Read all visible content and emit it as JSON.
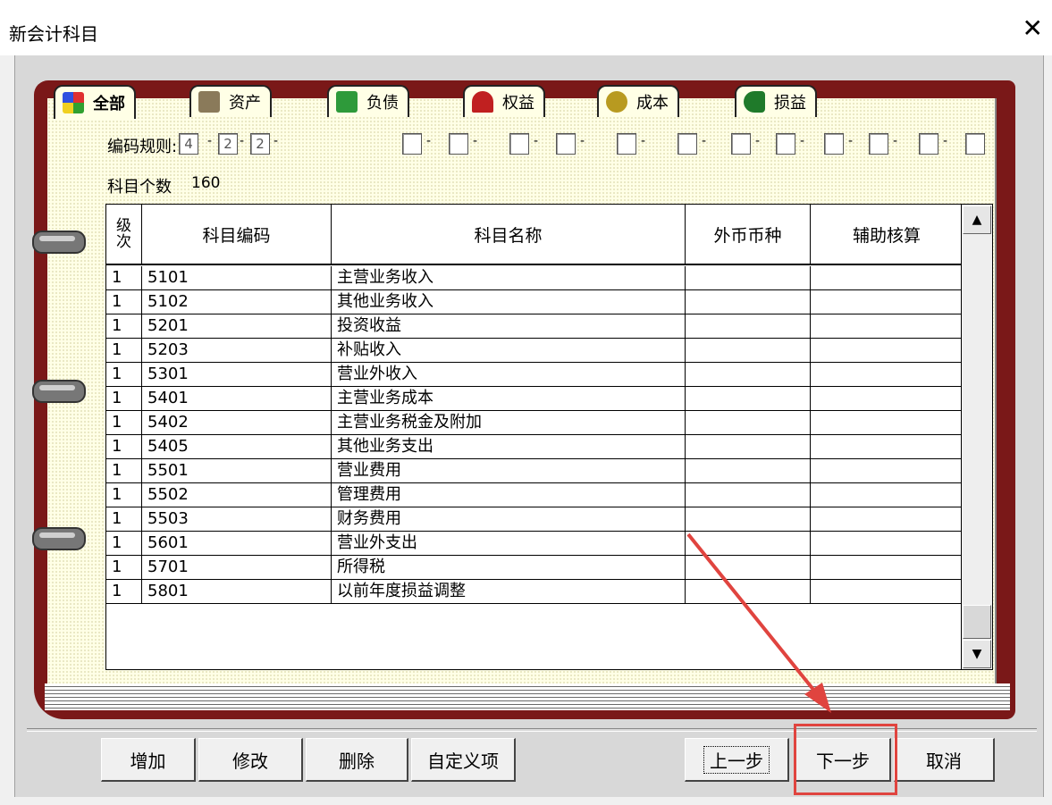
{
  "window": {
    "title": "新会计科目",
    "close": "✕"
  },
  "tabs": [
    {
      "label": "全部",
      "icon": "all-icon",
      "active": true
    },
    {
      "label": "资产",
      "icon": "asset-icon"
    },
    {
      "label": "负债",
      "icon": "liability-icon"
    },
    {
      "label": "权益",
      "icon": "equity-icon"
    },
    {
      "label": "成本",
      "icon": "cost-icon"
    },
    {
      "label": "损益",
      "icon": "profit-loss-icon"
    }
  ],
  "coding_rule": {
    "label": "编码规则:",
    "values": [
      "4",
      "2",
      "2"
    ]
  },
  "account_count": {
    "label": "科目个数",
    "value": "160"
  },
  "table": {
    "headers": [
      "级次",
      "科目编码",
      "科目名称",
      "外币币种",
      "辅助核算"
    ],
    "rows": [
      {
        "level": "1",
        "code": "5101",
        "name": "主营业务收入"
      },
      {
        "level": "1",
        "code": "5102",
        "name": "其他业务收入"
      },
      {
        "level": "1",
        "code": "5201",
        "name": "投资收益"
      },
      {
        "level": "1",
        "code": "5203",
        "name": "补贴收入"
      },
      {
        "level": "1",
        "code": "5301",
        "name": "营业外收入"
      },
      {
        "level": "1",
        "code": "5401",
        "name": "主营业务成本"
      },
      {
        "level": "1",
        "code": "5402",
        "name": "主营业务税金及附加"
      },
      {
        "level": "1",
        "code": "5405",
        "name": "其他业务支出"
      },
      {
        "level": "1",
        "code": "5501",
        "name": "营业费用"
      },
      {
        "level": "1",
        "code": "5502",
        "name": "管理费用"
      },
      {
        "level": "1",
        "code": "5503",
        "name": "财务费用"
      },
      {
        "level": "1",
        "code": "5601",
        "name": "营业外支出"
      },
      {
        "level": "1",
        "code": "5701",
        "name": "所得税"
      },
      {
        "level": "1",
        "code": "5801",
        "name": "以前年度损益调整"
      }
    ]
  },
  "buttons": {
    "add": "增加",
    "edit": "修改",
    "delete": "删除",
    "custom": "自定义项",
    "prev": "上一步",
    "next": "下一步",
    "cancel": "取消"
  },
  "colors": {
    "book_cover": "#7a1818",
    "page": "#ffffe6",
    "annotation": "#e0443f"
  }
}
